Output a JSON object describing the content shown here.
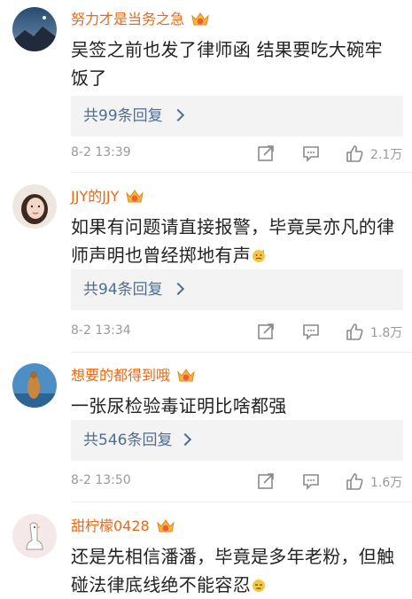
{
  "colors": {
    "username": "#e86a16",
    "reply_link": "#4f6e94",
    "meta": "#9a9a9a",
    "reply_bg": "#f3f3f3"
  },
  "comments": [
    {
      "username": "努力才是当务之急",
      "text": "吴签之前也发了律师函 结果要吃大碗牢饭了",
      "replies": "共99条回复",
      "time": "8-2 13:39",
      "likes": "2.1万"
    },
    {
      "username": "JJY的JJY",
      "text": "如果有问题请直接报警，毕竟吴亦凡的律师声明也曾经掷地有声",
      "emoji": "sweat-face-emoji",
      "replies": "共94条回复",
      "time": "8-2 13:34",
      "likes": "1.8万"
    },
    {
      "username": "想要的都得到哦",
      "text": "一张尿检验毒证明比啥都强",
      "replies": "共546条回复",
      "time": "8-2 13:50",
      "likes": "1.6万"
    },
    {
      "username": "甜柠檬0428",
      "text": "还是先相信潘潘，毕竟是多年老粉，但触碰法律底线绝不能容忍",
      "emoji": "neutral-face-emoji"
    }
  ],
  "icons": {
    "vip": "crown-badge-icon",
    "forward": "share-icon",
    "comment": "comment-icon",
    "like": "thumbs-up-icon"
  }
}
